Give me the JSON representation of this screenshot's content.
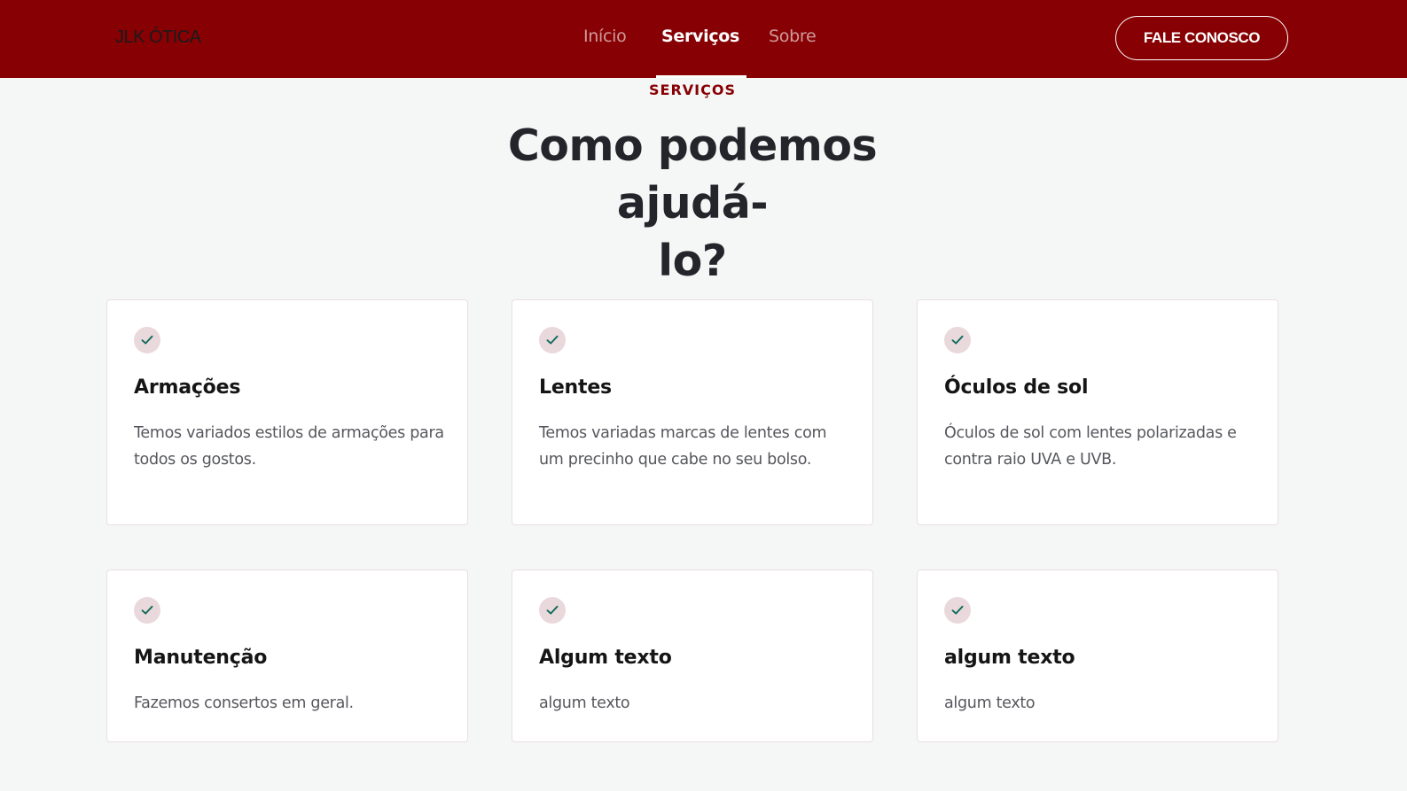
{
  "nav": {
    "brand": "JLK ÓTICA",
    "links": [
      "Início",
      "Serviços",
      "Sobre"
    ],
    "active": "Serviços",
    "cta": "FALE CONOSCO"
  },
  "section": {
    "eyebrow": "SERVIÇOS",
    "headline_line1": "Como podemos ajudá-",
    "headline_line2": "lo?"
  },
  "services": [
    {
      "title": "Armações",
      "text": "Temos variados estilos de armações para todos os gostos.",
      "icon": "check-icon"
    },
    {
      "title": "Lentes",
      "text": "Temos variadas marcas de lentes com um precinho que cabe no seu bolso.",
      "icon": "check-icon"
    },
    {
      "title": "Óculos de sol",
      "text": "Óculos de sol com lentes polarizadas e contra raio UVA e UVB.",
      "icon": "check-icon"
    },
    {
      "title": "Manutenção",
      "text": "Fazemos consertos em geral.",
      "icon": "check-icon"
    },
    {
      "title": "Algum texto",
      "text": "algum texto",
      "icon": "check-icon"
    },
    {
      "title": "algum texto",
      "text": "algum texto",
      "icon": "check-icon"
    }
  ],
  "colors": {
    "brand": "#870003",
    "check": "#0f6b5b",
    "check_bg": "#ead9dc"
  }
}
